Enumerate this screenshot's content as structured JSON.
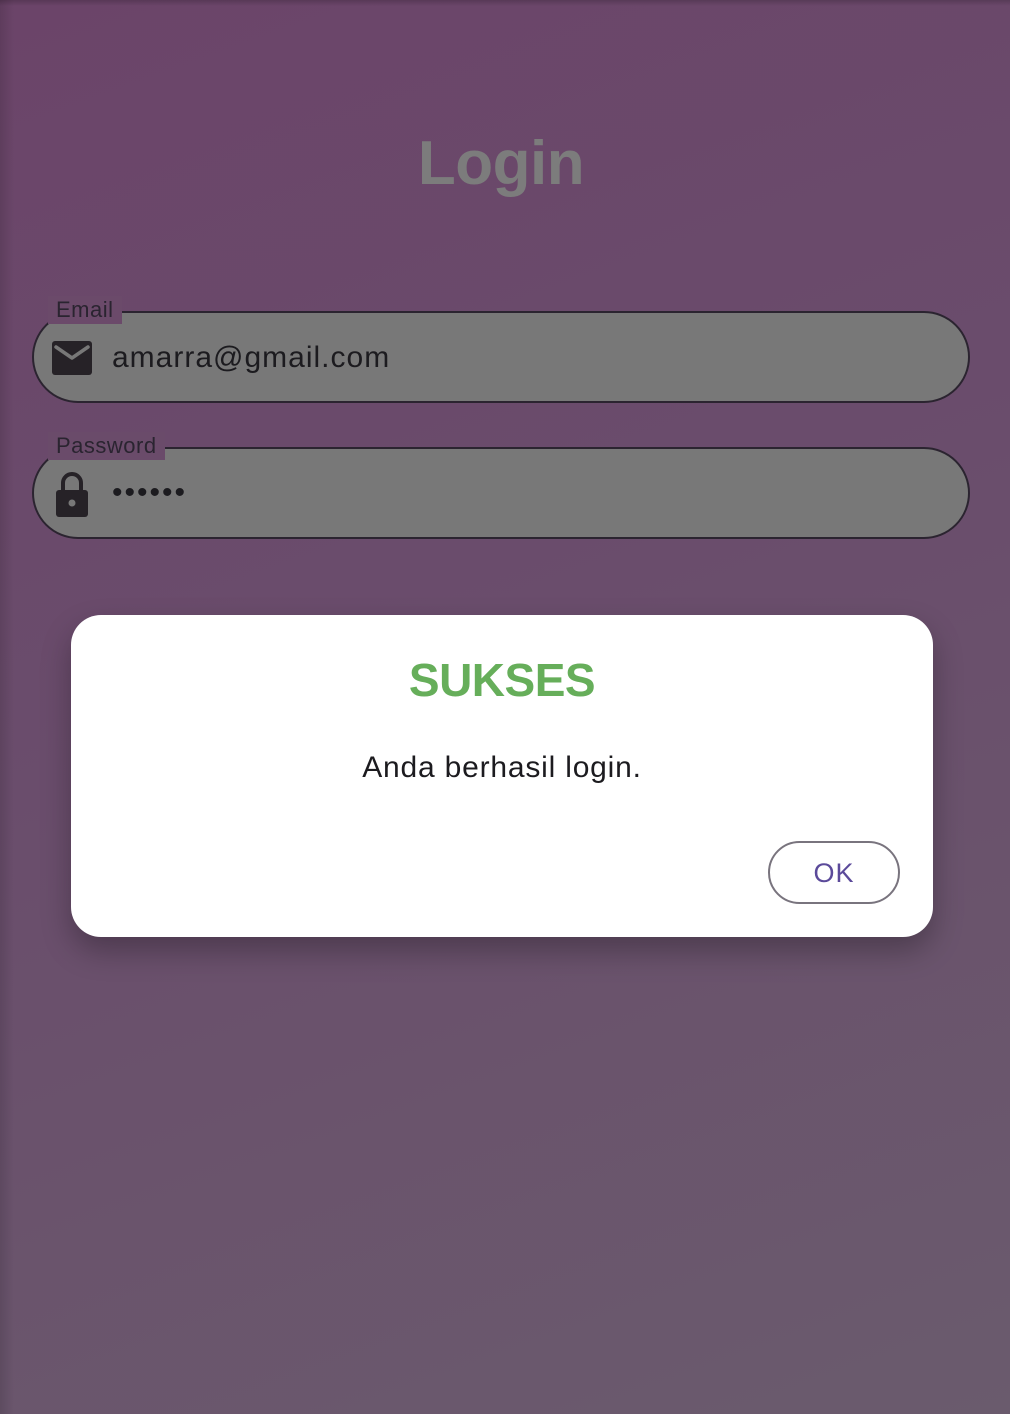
{
  "page": {
    "title": "Login"
  },
  "form": {
    "email": {
      "label": "Email",
      "value": "amarra@gmail.com",
      "icon": "mail-icon"
    },
    "password": {
      "label": "Password",
      "value": "••••••",
      "icon": "lock-icon"
    }
  },
  "dialog": {
    "title": "SUKSES",
    "message": "Anda berhasil login.",
    "ok_label": "OK"
  },
  "colors": {
    "background": "#6b4a6a",
    "field_fill": "#787878",
    "success_title": "#66ae5a",
    "button_text": "#5b4a9a"
  }
}
